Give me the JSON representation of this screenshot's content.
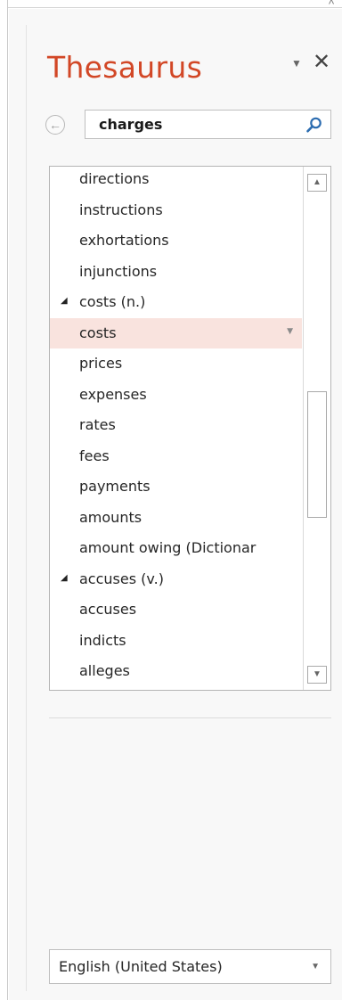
{
  "header": {
    "collapse_glyph": "^"
  },
  "pane": {
    "title": "Thesaurus",
    "options_glyph": "▼",
    "close_glyph": "✕"
  },
  "search": {
    "value": "charges",
    "back_glyph": "←"
  },
  "results": [
    {
      "text": "directions",
      "type": "item"
    },
    {
      "text": "instructions",
      "type": "item"
    },
    {
      "text": "exhortations",
      "type": "item"
    },
    {
      "text": "injunctions",
      "type": "item"
    },
    {
      "text": "costs (n.)",
      "type": "heading"
    },
    {
      "text": "costs",
      "type": "item",
      "selected": true
    },
    {
      "text": "prices",
      "type": "item"
    },
    {
      "text": "expenses",
      "type": "item"
    },
    {
      "text": "rates",
      "type": "item"
    },
    {
      "text": "fees",
      "type": "item"
    },
    {
      "text": "payments",
      "type": "item"
    },
    {
      "text": "amounts",
      "type": "item"
    },
    {
      "text": "amount owing (Dictionar",
      "type": "item"
    },
    {
      "text": "accuses (v.)",
      "type": "heading"
    },
    {
      "text": "accuses",
      "type": "item"
    },
    {
      "text": "indicts",
      "type": "item"
    },
    {
      "text": "alleges",
      "type": "item"
    }
  ],
  "scrollbar": {
    "up_glyph": "▲",
    "down_glyph": "▼"
  },
  "language": {
    "selected": "English (United States)",
    "caret_glyph": "▼"
  },
  "colors": {
    "title": "#d24726",
    "selected_row": "#f9e3de",
    "search_icon": "#2b6cb0"
  },
  "icons": {
    "back": "back-arrow-icon",
    "search": "search-icon",
    "close": "close-icon",
    "options": "dropdown-icon",
    "collapse": "chevron-up-icon"
  }
}
